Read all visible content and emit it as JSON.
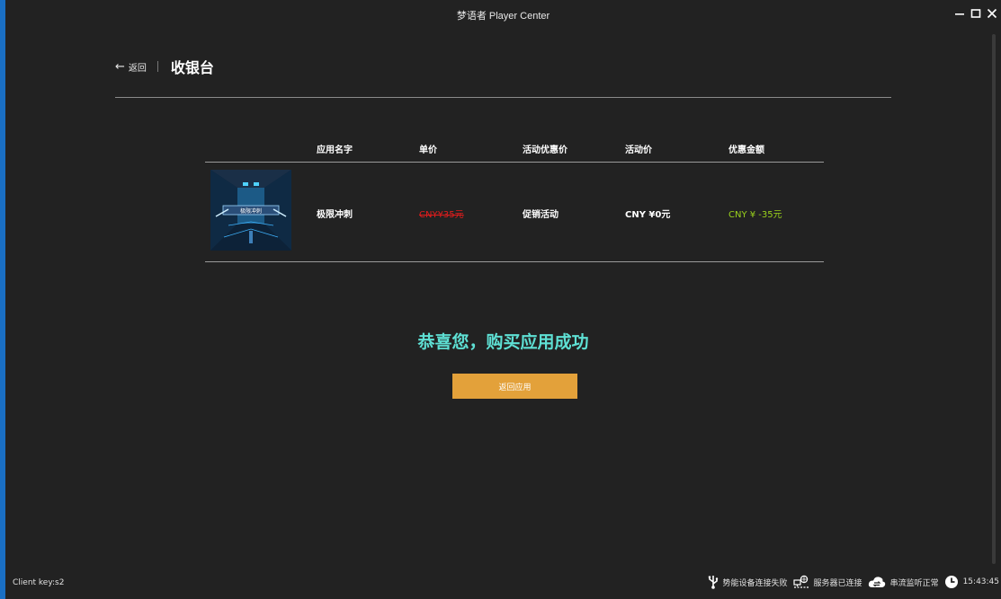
{
  "window": {
    "title": "梦语者 Player Center"
  },
  "header": {
    "back_label": "返回",
    "page_title": "收银台"
  },
  "table": {
    "columns": [
      "应用名字",
      "单价",
      "活动优惠价",
      "活动价",
      "优惠金额"
    ],
    "rows": [
      {
        "app_name": "极限冲刺",
        "unit_price": "CNY¥35元",
        "promo_type": "促销活动",
        "promo_price": "CNY ¥0元",
        "discount_amount": "CNY ¥ -35元",
        "thumbnail_caption": "极限冲刺"
      }
    ]
  },
  "result": {
    "message": "恭喜您，购买应用成功",
    "button_label": "返回应用"
  },
  "statusbar": {
    "client_key": "Client key:s2",
    "device_status": "势能设备连接失败",
    "server_status": "服务器已连接",
    "stream_status": "串流监听正常",
    "time": "15:43:45"
  },
  "colors": {
    "background": "#222222",
    "accent_button": "#e3a13a",
    "success_text": "#5ee0d4",
    "price_strike": "#e31c1c",
    "discount": "#9ad21c"
  }
}
